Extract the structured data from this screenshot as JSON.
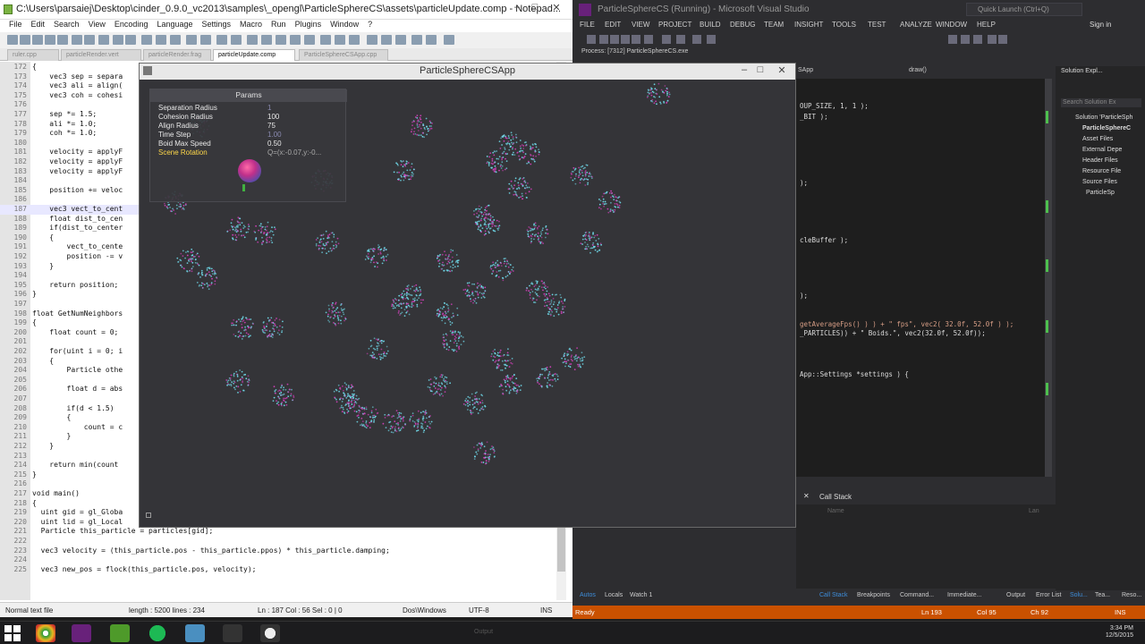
{
  "npp": {
    "title": "C:\\Users\\parsaiej\\Desktop\\cinder_0.9.0_vc2013\\samples\\_opengl\\ParticleSphereCS\\assets\\particleUpdate.comp - Notepad...",
    "menu": [
      "File",
      "Edit",
      "Search",
      "View",
      "Encoding",
      "Language",
      "Settings",
      "Macro",
      "Run",
      "Plugins",
      "Window",
      "?"
    ],
    "tabs": [
      "ruler.cpp",
      "particleRender.vert",
      "particleRender.frag",
      "particleUpdate.comp",
      "ParticleSphereCSApp.cpp"
    ],
    "code": [
      {
        "n": "172",
        "t": "{"
      },
      {
        "n": "173",
        "t": "    vec3 sep = separa"
      },
      {
        "n": "174",
        "t": "    vec3 ali = align("
      },
      {
        "n": "175",
        "t": "    vec3 coh = cohesi"
      },
      {
        "n": "176",
        "t": ""
      },
      {
        "n": "177",
        "t": "    sep *= 1.5;"
      },
      {
        "n": "178",
        "t": "    ali *= 1.0;"
      },
      {
        "n": "179",
        "t": "    coh *= 1.0;"
      },
      {
        "n": "180",
        "t": ""
      },
      {
        "n": "181",
        "t": "    velocity = applyF"
      },
      {
        "n": "182",
        "t": "    velocity = applyF"
      },
      {
        "n": "183",
        "t": "    velocity = applyF"
      },
      {
        "n": "184",
        "t": ""
      },
      {
        "n": "185",
        "t": "    position += veloc"
      },
      {
        "n": "186",
        "t": ""
      },
      {
        "n": "187",
        "t": "    vec3 vect_to_cent"
      },
      {
        "n": "188",
        "t": "    float dist_to_cen"
      },
      {
        "n": "189",
        "t": "    if(dist_to_center"
      },
      {
        "n": "190",
        "t": "    {"
      },
      {
        "n": "191",
        "t": "        vect_to_cente"
      },
      {
        "n": "192",
        "t": "        position -= v"
      },
      {
        "n": "193",
        "t": "    }"
      },
      {
        "n": "194",
        "t": ""
      },
      {
        "n": "195",
        "t": "    return position;"
      },
      {
        "n": "196",
        "t": "}"
      },
      {
        "n": "197",
        "t": ""
      },
      {
        "n": "198",
        "t": "float GetNumNeighbors"
      },
      {
        "n": "199",
        "t": "{"
      },
      {
        "n": "200",
        "t": "    float count = 0;"
      },
      {
        "n": "201",
        "t": ""
      },
      {
        "n": "202",
        "t": "    for(uint i = 0; i"
      },
      {
        "n": "203",
        "t": "    {"
      },
      {
        "n": "204",
        "t": "        Particle othe"
      },
      {
        "n": "205",
        "t": ""
      },
      {
        "n": "206",
        "t": "        float d = abs"
      },
      {
        "n": "207",
        "t": ""
      },
      {
        "n": "208",
        "t": "        if(d < 1.5)"
      },
      {
        "n": "209",
        "t": "        {"
      },
      {
        "n": "210",
        "t": "            count = c"
      },
      {
        "n": "211",
        "t": "        }"
      },
      {
        "n": "212",
        "t": "    }"
      },
      {
        "n": "213",
        "t": ""
      },
      {
        "n": "214",
        "t": "    return min(count"
      },
      {
        "n": "215",
        "t": "}"
      },
      {
        "n": "216",
        "t": ""
      },
      {
        "n": "217",
        "t": "void main()"
      },
      {
        "n": "218",
        "t": "{"
      },
      {
        "n": "219",
        "t": "  uint gid = gl_Globa"
      },
      {
        "n": "220",
        "t": "  uint lid = gl_Local"
      },
      {
        "n": "221",
        "t": "  Particle this_particle = particles[gid];"
      },
      {
        "n": "222",
        "t": ""
      },
      {
        "n": "223",
        "t": "  vec3 velocity = (this_particle.pos - this_particle.ppos) * this_particle.damping;"
      },
      {
        "n": "224",
        "t": ""
      },
      {
        "n": "225",
        "t": "  vec3 new_pos = flock(this_particle.pos, velocity);"
      }
    ],
    "status": {
      "type": "Normal text file",
      "length": "length : 5200   lines : 234",
      "pos": "Ln : 187   Col : 56   Sel : 0 | 0",
      "eol": "Dos\\Windows",
      "enc": "UTF-8",
      "mode": "INS"
    }
  },
  "vs": {
    "title": "ParticleSphereCS (Running) - Microsoft Visual Studio",
    "quick_launch": "Quick Launch (Ctrl+Q)",
    "menu": [
      "FILE",
      "EDIT",
      "VIEW",
      "PROJECT",
      "BUILD",
      "DEBUG",
      "TEAM",
      "INSIGHT",
      "TOOLS",
      "TEST",
      "ANALYZE",
      "WINDOW",
      "HELP"
    ],
    "sign_in": "Sign in",
    "process": "Process:  [7312] ParticleSphereCS.exe",
    "editor_tab_left": "SApp",
    "editor_tab_right": "draw()",
    "code": [
      {
        "t": "OUP_SIZE, 1, 1 );",
        "red": false
      },
      {
        "t": "_BIT );",
        "red": false
      },
      {
        "t": ");",
        "red": false
      },
      {
        "t": "cleBuffer );",
        "red": false
      },
      {
        "t": ");",
        "red": false
      },
      {
        "t": "getAverageFps() ) ) + \" fps\", vec2( 32.0f, 52.0f ) );",
        "red": true
      },
      {
        "t": "_PARTICLES)) + \" Boids.\", vec2(32.0f, 52.0f));",
        "red": false
      },
      {
        "t": "App::Settings *settings ) {",
        "red": false
      }
    ],
    "solution": {
      "header": "Solution Expl...",
      "search": "Search Solution Ex",
      "items": [
        "Solution 'ParticleSph",
        "ParticleSphereC",
        "Asset Files",
        "External Depe",
        "Header Files",
        "Resource File",
        "Source Files",
        "ParticleSp"
      ]
    },
    "callstack": {
      "title": "Call Stack",
      "col_name": "Name",
      "col_lang": "Lan"
    },
    "bottom_tabs": [
      "Autos",
      "Locals",
      "Watch 1",
      "Call Stack",
      "Breakpoints",
      "Command...",
      "Immediate...",
      "Output",
      "Error List",
      "Solu...",
      "Tea...",
      "Reso..."
    ],
    "status": {
      "state": "Ready",
      "ln": "Ln 193",
      "col": "Col 95",
      "ch": "Ch 92",
      "mode": "INS"
    }
  },
  "app": {
    "title": "ParticleSphereCSApp",
    "params_title": "Params",
    "params": [
      {
        "label": "Separation Radius",
        "value": "1"
      },
      {
        "label": "Cohesion Radius",
        "value": "100"
      },
      {
        "label": "Align Radius",
        "value": "75"
      },
      {
        "label": "Time Step",
        "value": "1.00"
      },
      {
        "label": "Boid Max Speed",
        "value": "0.50"
      },
      {
        "label": "Scene Rotation",
        "value": "Q=(x:-0.07,y:-0..."
      }
    ]
  },
  "taskbar": {
    "tray_items": [
      "Output"
    ],
    "time": "3:34 PM",
    "date": "12/5/2015"
  },
  "colors": {
    "npp_bg": "#ffffff",
    "vs_bg": "#2d2d30",
    "vs_status": "#ca5100",
    "particle_cyan": "#6fd8e8",
    "particle_magenta": "#d040b8",
    "rotation_label": "#ffd84a"
  }
}
